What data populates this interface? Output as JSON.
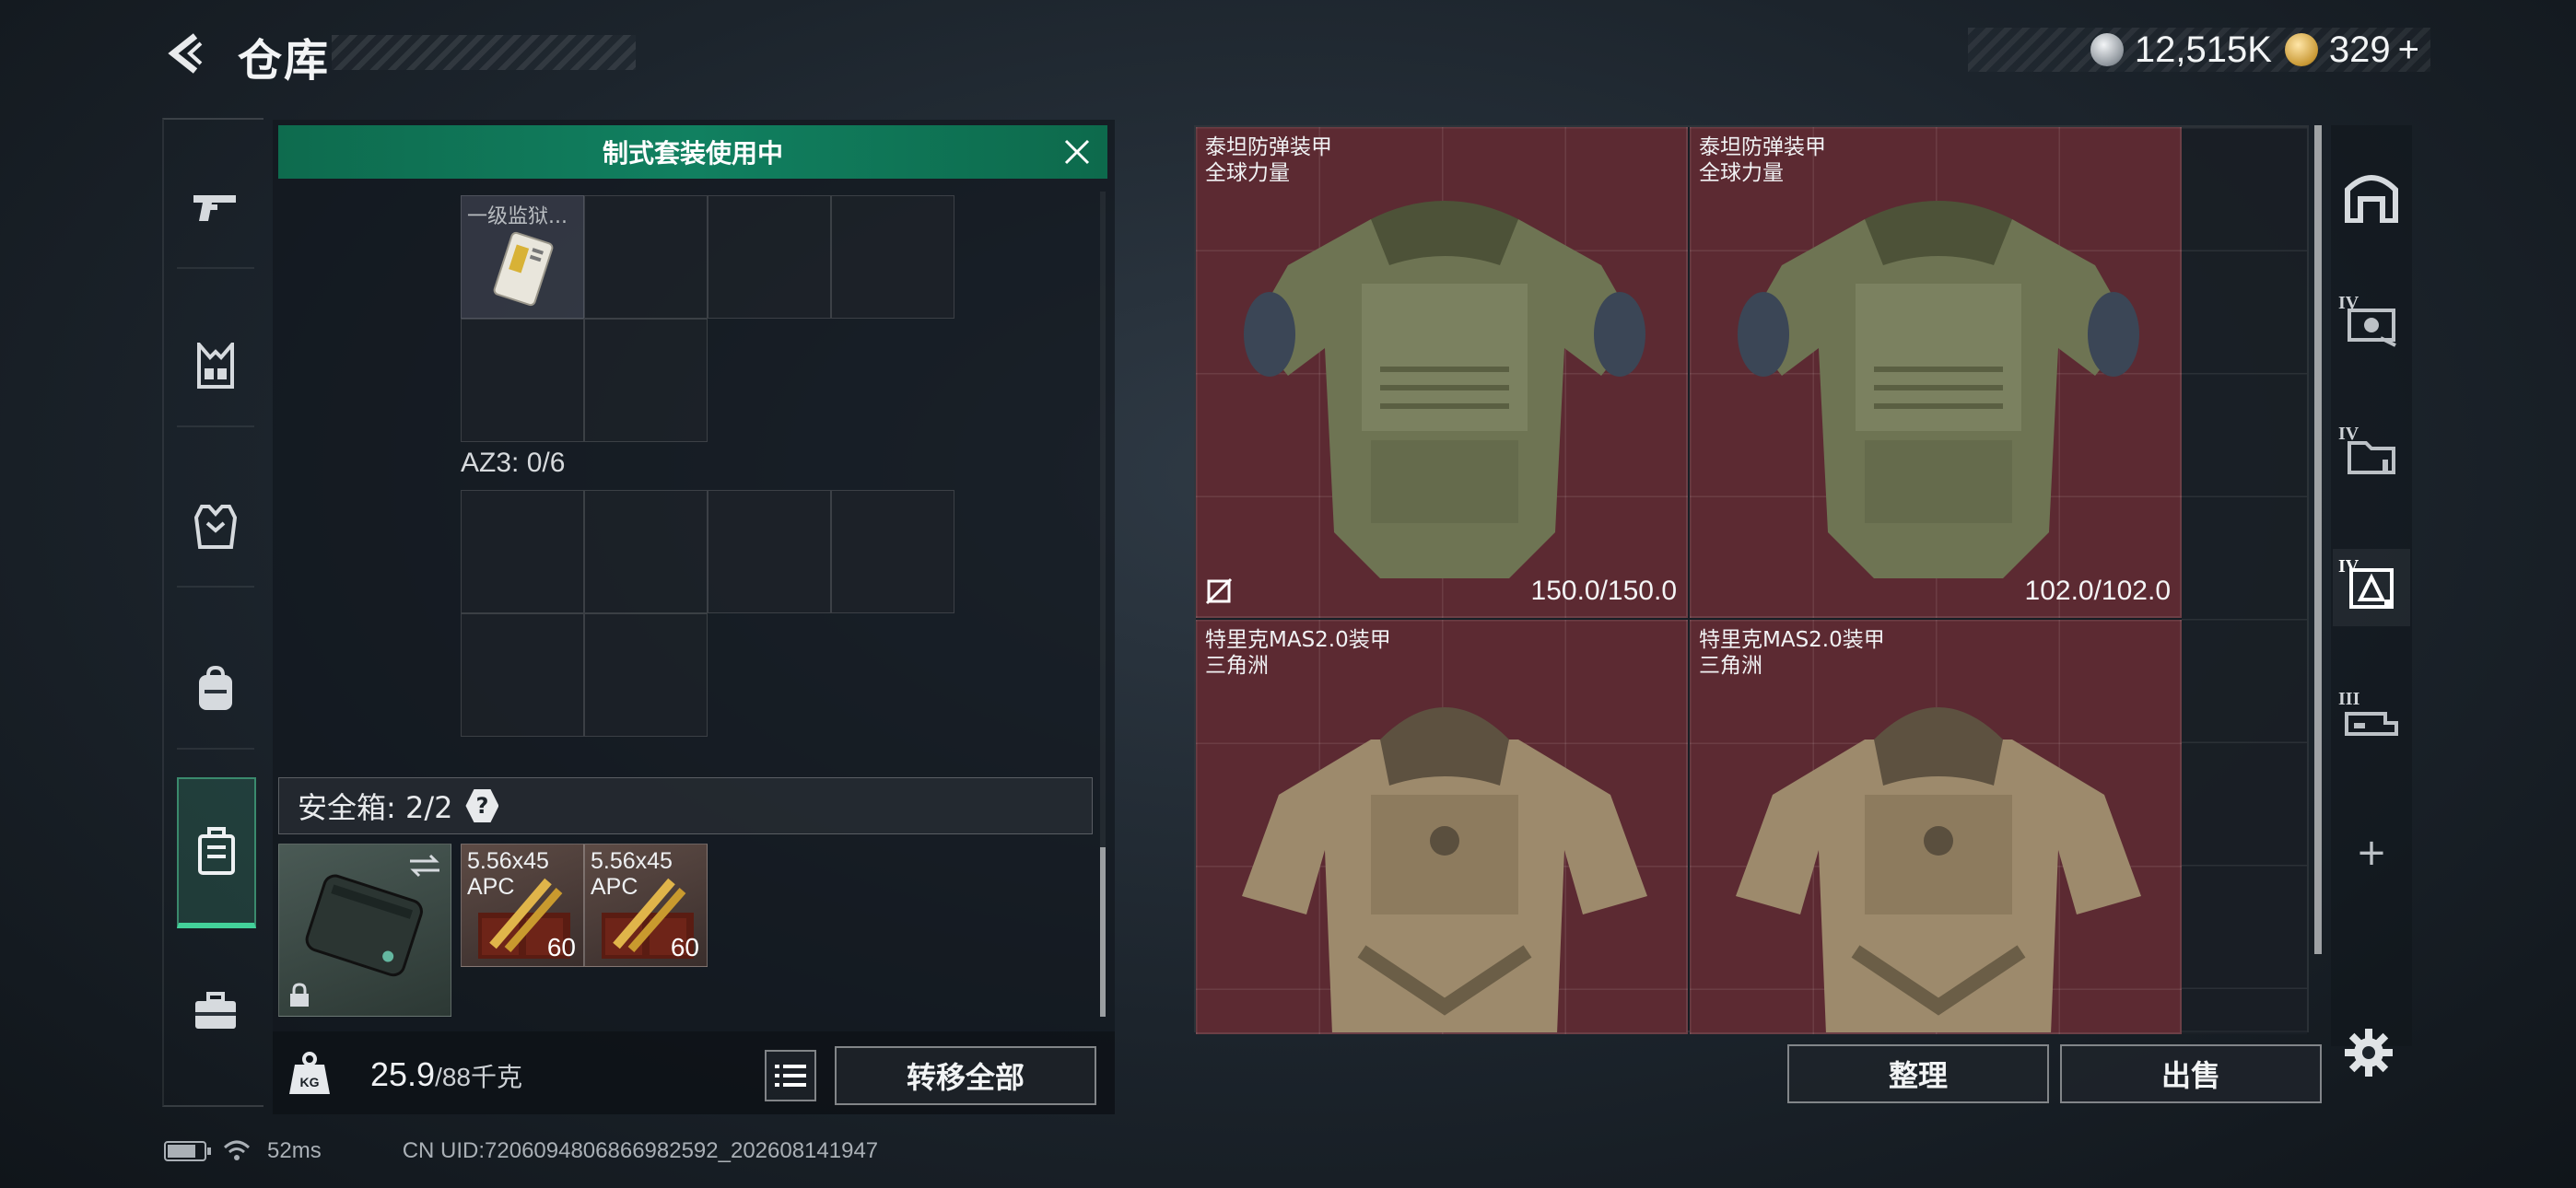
{
  "header": {
    "title": "仓库",
    "currency_silver": "12,515K",
    "currency_gold": "329",
    "currency_gold_add": "+"
  },
  "loadout": {
    "banner": "制式套装使用中",
    "rig_item_label": "一级监狱...",
    "az3_label": "AZ3: 0/6",
    "safebox_label": "安全箱: 2/2",
    "safebox_help": "?",
    "ammo": [
      {
        "label": "5.56x45\nAPC",
        "count": "60"
      },
      {
        "label": "5.56x45\nAPC",
        "count": "60"
      }
    ],
    "weight_current": "25.9",
    "weight_max": "/88千克",
    "transfer_all": "转移全部"
  },
  "stash": {
    "items": [
      {
        "name": "泰坦防弹装甲",
        "sub": "全球力量",
        "durability": "150.0/150.0"
      },
      {
        "name": "泰坦防弹装甲",
        "sub": "全球力量",
        "durability": "102.0/102.0"
      },
      {
        "name": "特里克MAS2.0装甲",
        "sub": "三角洲",
        "durability": ""
      },
      {
        "name": "特里克MAS2.0装甲",
        "sub": "三角洲",
        "durability": ""
      }
    ],
    "sort_button": "整理",
    "sell_button": "出售"
  },
  "right_tabs": {
    "tier_iv_a": "IV",
    "tier_iv_b": "IV",
    "tier_iv_c": "IV",
    "tier_iii": "III",
    "add": "+"
  },
  "statusbar": {
    "ping": "52ms",
    "uid": "CN UID:7206094806866982592_202608141947"
  },
  "colors": {
    "accent_green": "#118060",
    "card_red": "#5c2a32",
    "active_tab": "#43d19a"
  }
}
